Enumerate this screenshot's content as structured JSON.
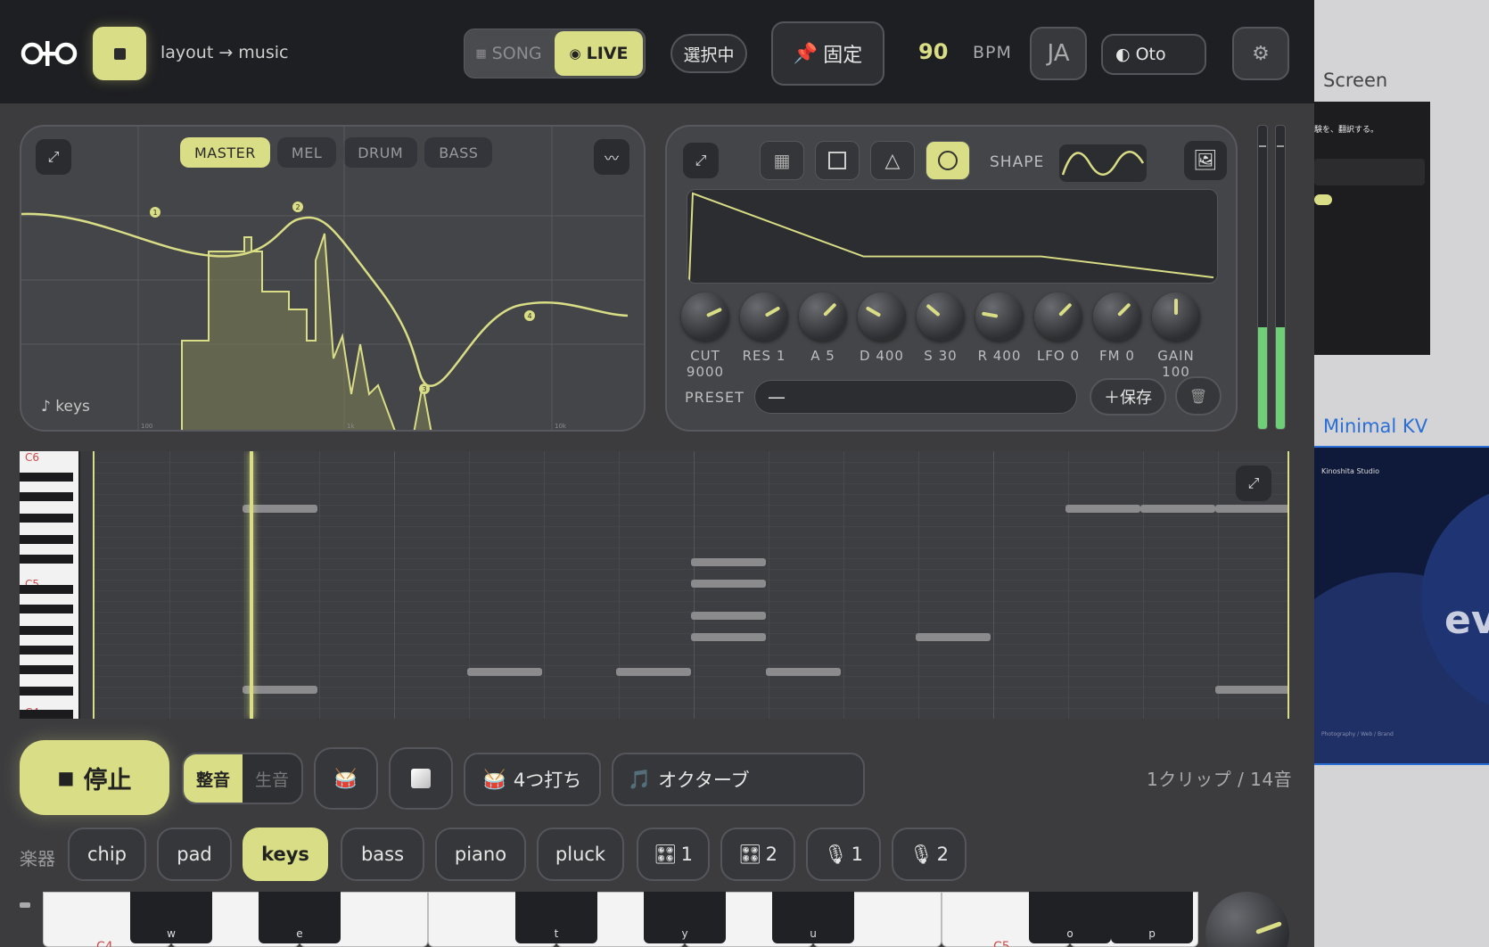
{
  "header": {
    "crumb": "layout → music",
    "mode_song": "SONG",
    "mode_live": "LIVE",
    "selected_label": "選択中",
    "pin_label": "固定",
    "bpm_value": "90",
    "bpm_label": "BPM",
    "lang": "JA",
    "theme_label": "Oto"
  },
  "eq": {
    "tabs": [
      "MASTER",
      "MEL",
      "DRUM",
      "BASS"
    ],
    "active_tab": "MASTER",
    "track_label": "keys",
    "band_markers": [
      "1",
      "2",
      "3",
      "4"
    ],
    "freq_ticks": [
      "100",
      "1k",
      "10k"
    ]
  },
  "synth": {
    "shape_label": "SHAPE",
    "active_shape": "sine",
    "knobs": [
      {
        "label": "CUT 9000"
      },
      {
        "label": "RES 1"
      },
      {
        "label": "A 5"
      },
      {
        "label": "D 400"
      },
      {
        "label": "S 30"
      },
      {
        "label": "R 400"
      },
      {
        "label": "LFO 0"
      },
      {
        "label": "FM 0"
      },
      {
        "label": "GAIN 100"
      }
    ],
    "preset_label": "PRESET",
    "preset_value": "—",
    "save_label": "＋保存"
  },
  "roll": {
    "octave_labels": [
      "C6",
      "C5",
      "C4"
    ]
  },
  "transport": {
    "stop_label": "停止",
    "tone_options": [
      "整音",
      "生音"
    ],
    "active_tone": "整音",
    "pattern_label": "4つ打ち",
    "scale_label": "オクターブ",
    "count": "1クリップ / 14音"
  },
  "instruments": {
    "label": "楽器",
    "items": [
      "chip",
      "pad",
      "keys",
      "bass",
      "piano",
      "pluck",
      "1",
      "2",
      "1",
      "2"
    ],
    "active": "keys"
  },
  "keyboard": {
    "black_keys": [
      "w",
      "e",
      "t",
      "y",
      "u",
      "o",
      "p"
    ],
    "white_labels": [
      "C4",
      "C5"
    ]
  },
  "sidebar": {
    "title": "Screen",
    "link": "Minimal KV",
    "shot1_lines": [
      "験を、翻訳する。"
    ],
    "shot2_brand": "Kinoshita Studio",
    "shot2_big": "ev",
    "shot2_footer": "Photography / Web / Brand"
  },
  "colors": {
    "accent": "#d9dd85",
    "meter": "#6fcf76",
    "link": "#2a6fd6"
  }
}
